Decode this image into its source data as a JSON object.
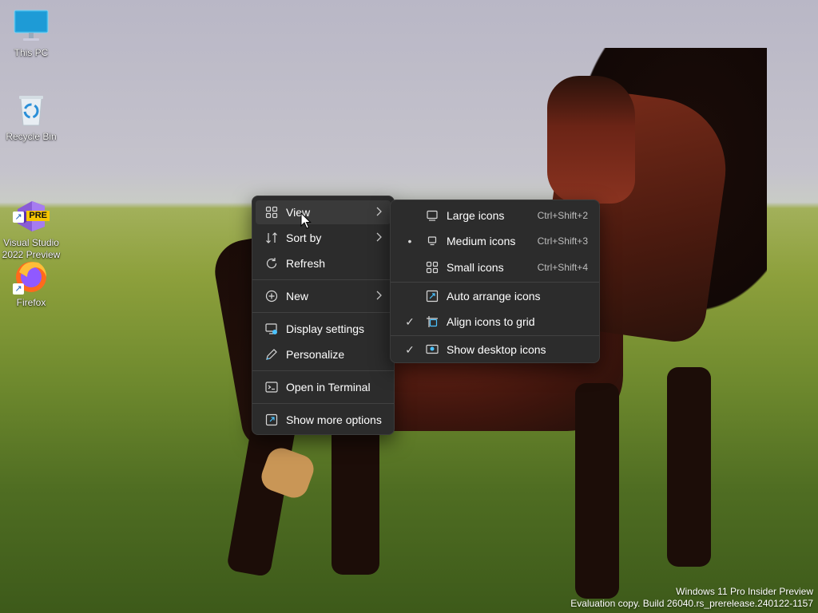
{
  "desktop": {
    "icons": [
      {
        "label": "This PC",
        "icon": "monitor-icon"
      },
      {
        "label": "Recycle Bin",
        "icon": "recycle-bin-icon"
      },
      {
        "label": "Visual Studio\n2022 Preview",
        "badge": "PRE",
        "icon": "visual-studio-icon"
      },
      {
        "label": "Firefox",
        "icon": "firefox-icon"
      }
    ]
  },
  "context_menu": {
    "items": [
      {
        "label": "View",
        "icon": "view-grid-icon",
        "has_submenu": true
      },
      {
        "label": "Sort by",
        "icon": "sort-icon",
        "has_submenu": true
      },
      {
        "label": "Refresh",
        "icon": "refresh-icon"
      },
      {
        "label": "New",
        "icon": "new-plus-icon",
        "has_submenu": true
      },
      {
        "label": "Display settings",
        "icon": "display-settings-icon"
      },
      {
        "label": "Personalize",
        "icon": "personalize-pen-icon"
      },
      {
        "label": "Open in Terminal",
        "icon": "terminal-icon"
      },
      {
        "label": "Show more options",
        "icon": "show-more-icon"
      }
    ]
  },
  "view_submenu": {
    "items": [
      {
        "label": "Large icons",
        "shortcut": "Ctrl+Shift+2",
        "icon": "large-icons-icon",
        "mark": ""
      },
      {
        "label": "Medium icons",
        "shortcut": "Ctrl+Shift+3",
        "icon": "medium-icons-icon",
        "mark": "•"
      },
      {
        "label": "Small icons",
        "shortcut": "Ctrl+Shift+4",
        "icon": "small-icons-icon",
        "mark": ""
      },
      {
        "label": "Auto arrange icons",
        "shortcut": "",
        "icon": "auto-arrange-icon",
        "mark": ""
      },
      {
        "label": "Align icons to grid",
        "shortcut": "",
        "icon": "align-grid-icon",
        "mark": "✓"
      },
      {
        "label": "Show desktop icons",
        "shortcut": "",
        "icon": "show-desktop-icon",
        "mark": "✓"
      }
    ]
  },
  "watermark": {
    "line1": "Windows 11 Pro Insider Preview",
    "line2": "Evaluation copy. Build 26040.rs_prerelease.240122-1157"
  },
  "colors": {
    "menu_bg": "#2c2c2c",
    "menu_hover": "#3a3a3a",
    "accent": "#4cc2ff"
  }
}
